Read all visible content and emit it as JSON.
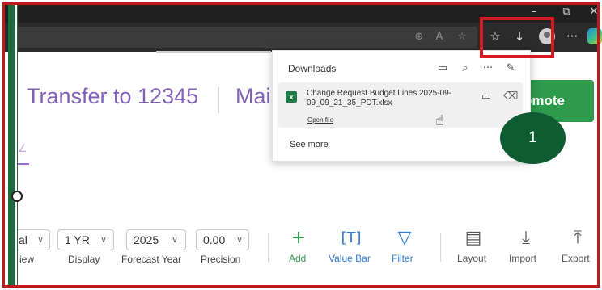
{
  "browser": {
    "window_controls": {
      "minimize": "–",
      "restore": "⧉",
      "close": "✕"
    },
    "toolbar_icons": [
      "zoom-icon",
      "read-aloud-icon",
      "favorite-icon",
      "favorites-icon",
      "downloads-icon",
      "profile-icon",
      "more-icon",
      "copilot-icon"
    ],
    "more_label": "···"
  },
  "page": {
    "title": "Transfer to 12345",
    "title_partial": "Mai",
    "promote_label": "omote",
    "callout_number": "1"
  },
  "downloads": {
    "title": "Downloads",
    "item": {
      "file_name": "Change Request Budget Lines 2025-09-09_09_21_35_PDT.xlsx",
      "open_label": "Open file"
    },
    "see_more": "See more"
  },
  "toolbar": {
    "selects": [
      {
        "value": "al",
        "caption": "iew"
      },
      {
        "value": "1 YR",
        "caption": "Display"
      },
      {
        "value": "2025",
        "caption": "Forecast Year"
      },
      {
        "value": "0.00",
        "caption": "Precision"
      }
    ],
    "actions": [
      {
        "label": "Add",
        "icon": "plus-icon"
      },
      {
        "label": "Value Bar",
        "icon": "value-bar-icon"
      },
      {
        "label": "Filter",
        "icon": "filter-icon"
      },
      {
        "label": "Layout",
        "icon": "layout-icon"
      },
      {
        "label": "Import",
        "icon": "import-icon"
      },
      {
        "label": "Export",
        "icon": "export-icon"
      }
    ]
  },
  "colors": {
    "accent_purple": "#8060b8",
    "promote_green": "#2e9a4c",
    "callout_green": "#0f5c32",
    "annotation_red": "#d71a20",
    "link_blue": "#2f7bd8"
  }
}
